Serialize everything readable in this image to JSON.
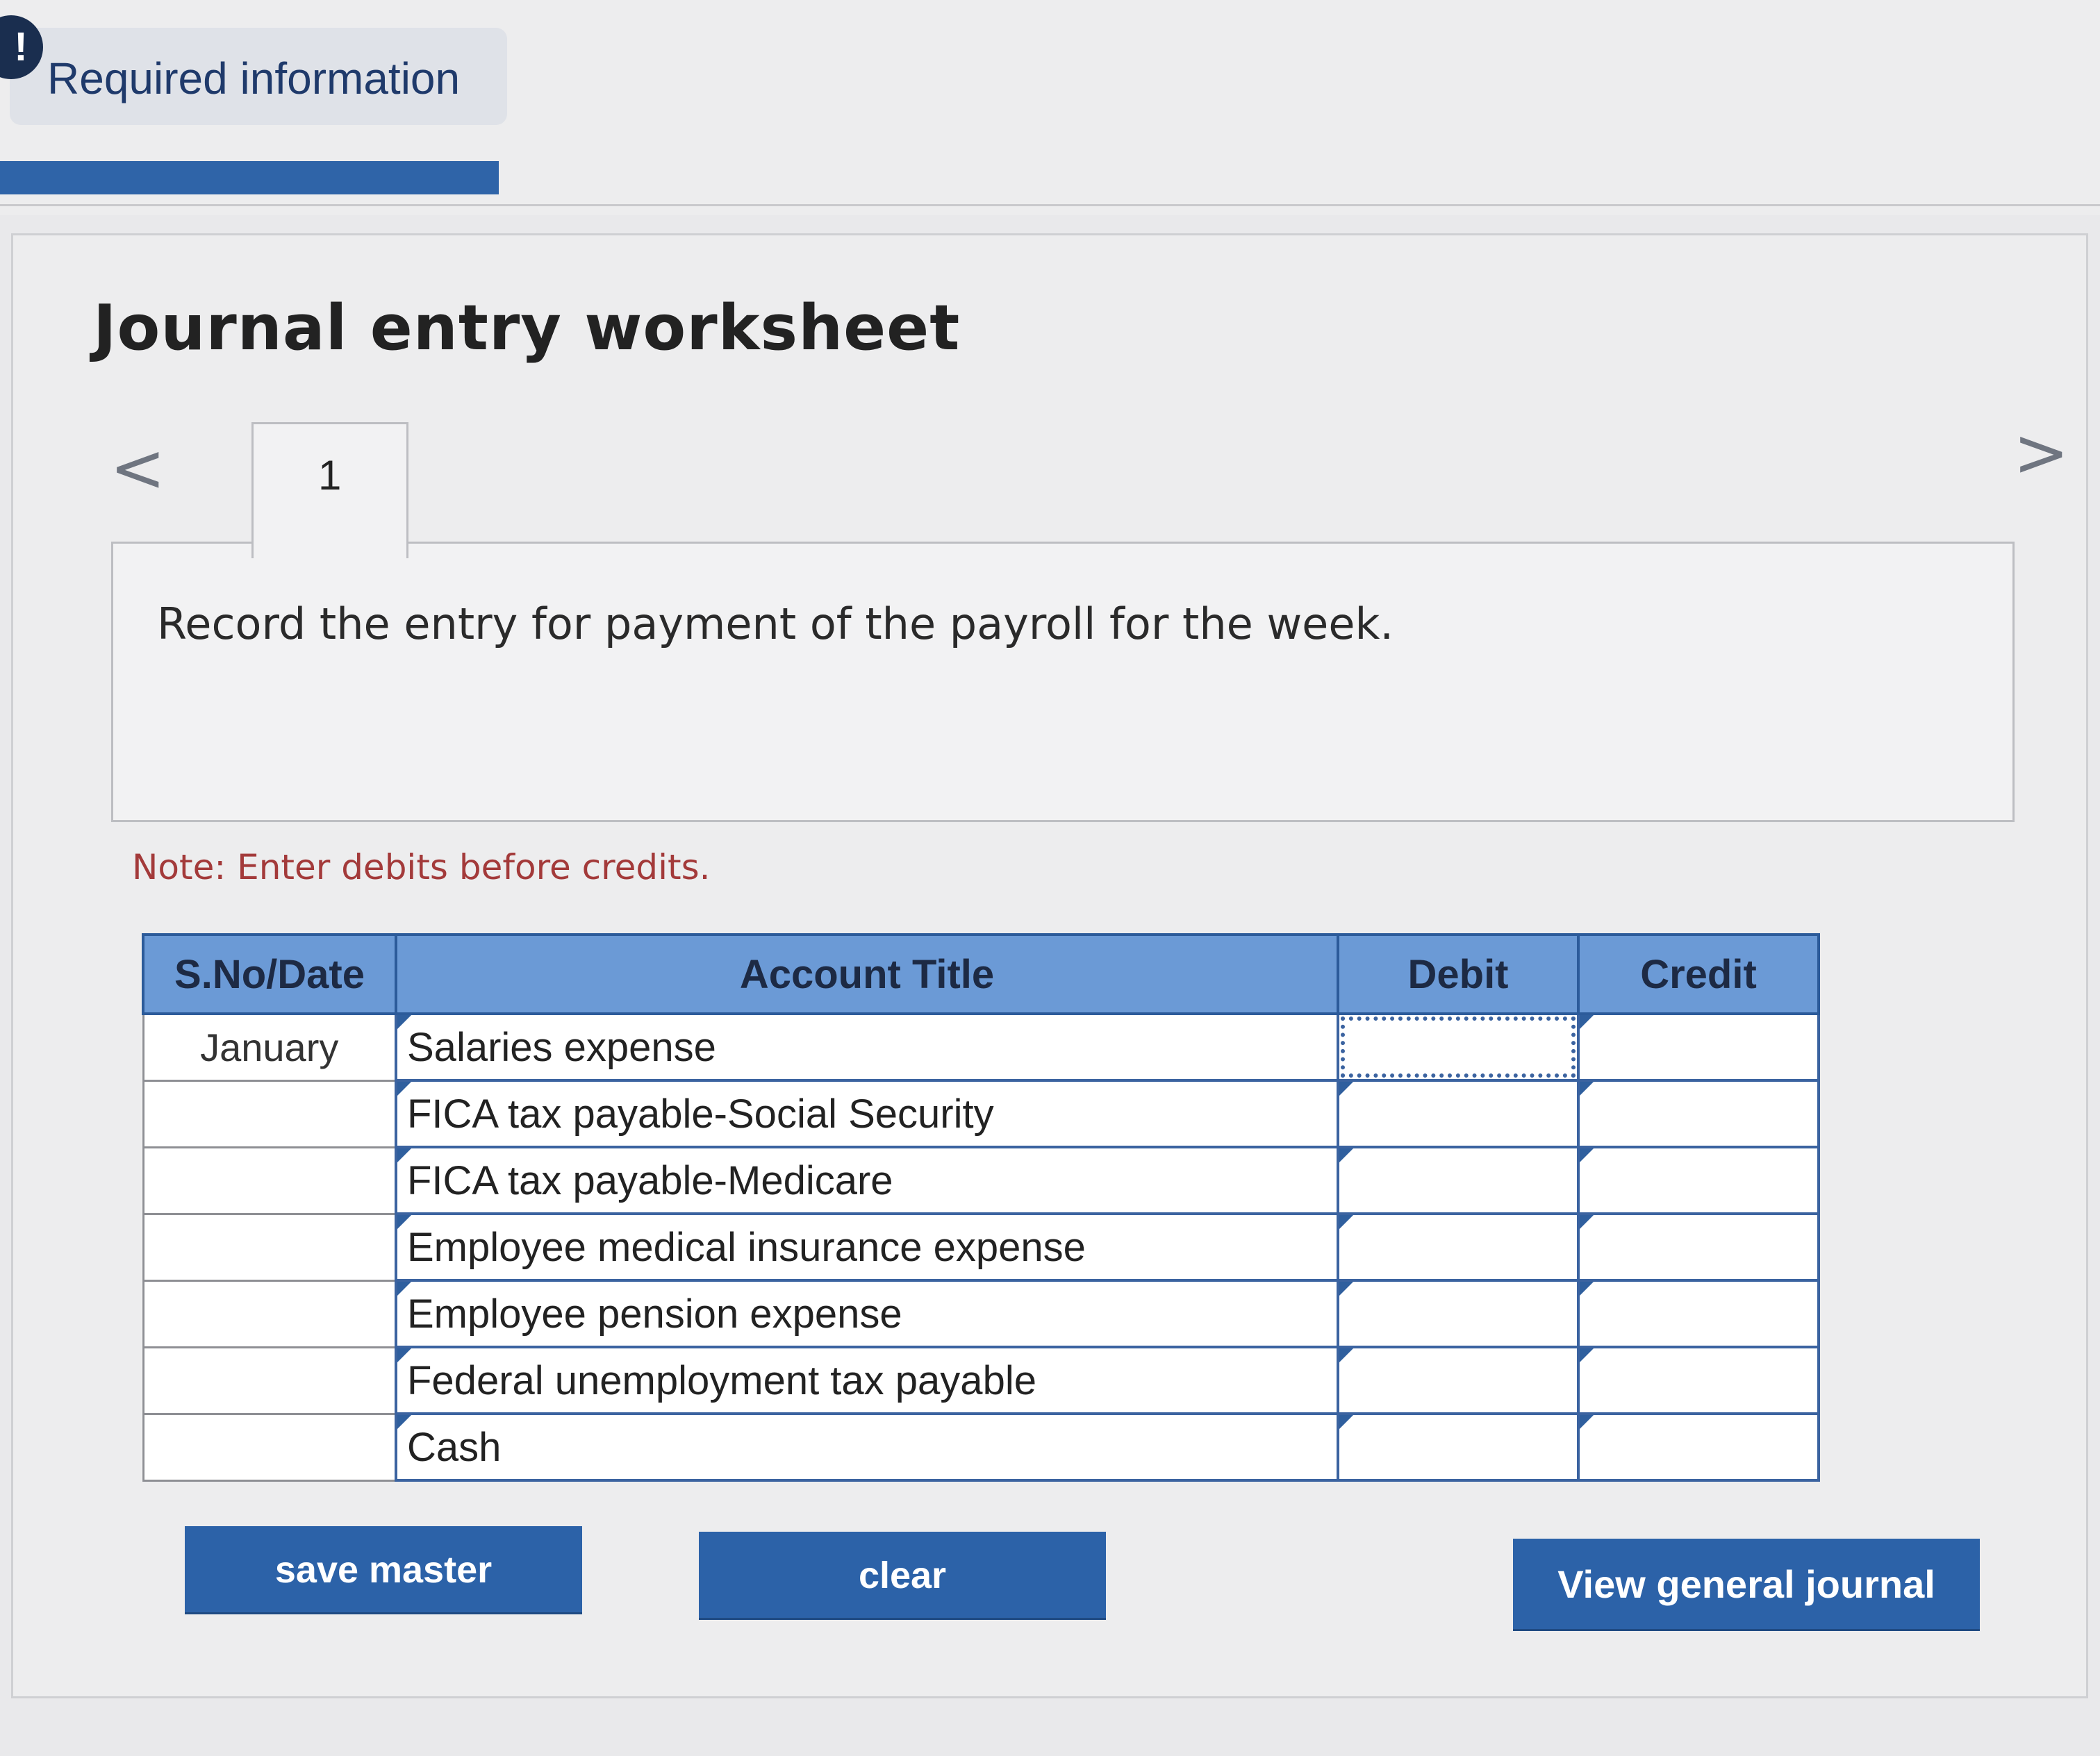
{
  "header": {
    "alert_symbol": "!",
    "required_label": "Required information"
  },
  "worksheet": {
    "title": "Journal entry worksheet",
    "prev_arrow": "<",
    "next_arrow": ">",
    "tabs": [
      {
        "label": "1",
        "active": true
      }
    ],
    "question": "Record the entry for payment of the payroll for the week.",
    "note": "Note: Enter debits before credits."
  },
  "table": {
    "headers": {
      "date": "S.No/Date",
      "account": "Account Title",
      "debit": "Debit",
      "credit": "Credit"
    },
    "rows": [
      {
        "date": "January",
        "account": "Salaries expense",
        "debit": "",
        "credit": ""
      },
      {
        "date": "",
        "account": "FICA tax payable-Social Security",
        "debit": "",
        "credit": ""
      },
      {
        "date": "",
        "account": "FICA tax payable-Medicare",
        "debit": "",
        "credit": ""
      },
      {
        "date": "",
        "account": "Employee medical insurance expense",
        "debit": "",
        "credit": ""
      },
      {
        "date": "",
        "account": "Employee pension expense",
        "debit": "",
        "credit": ""
      },
      {
        "date": "",
        "account": "Federal unemployment tax payable",
        "debit": "",
        "credit": ""
      },
      {
        "date": "",
        "account": "Cash",
        "debit": "",
        "credit": ""
      }
    ]
  },
  "buttons": {
    "save_master": "save master",
    "clear": "clear",
    "view_general_journal": "View general journal"
  },
  "colors": {
    "accent_blue": "#2c62a8",
    "header_blue": "#6b9ad6",
    "note_red": "#a33a3a"
  }
}
